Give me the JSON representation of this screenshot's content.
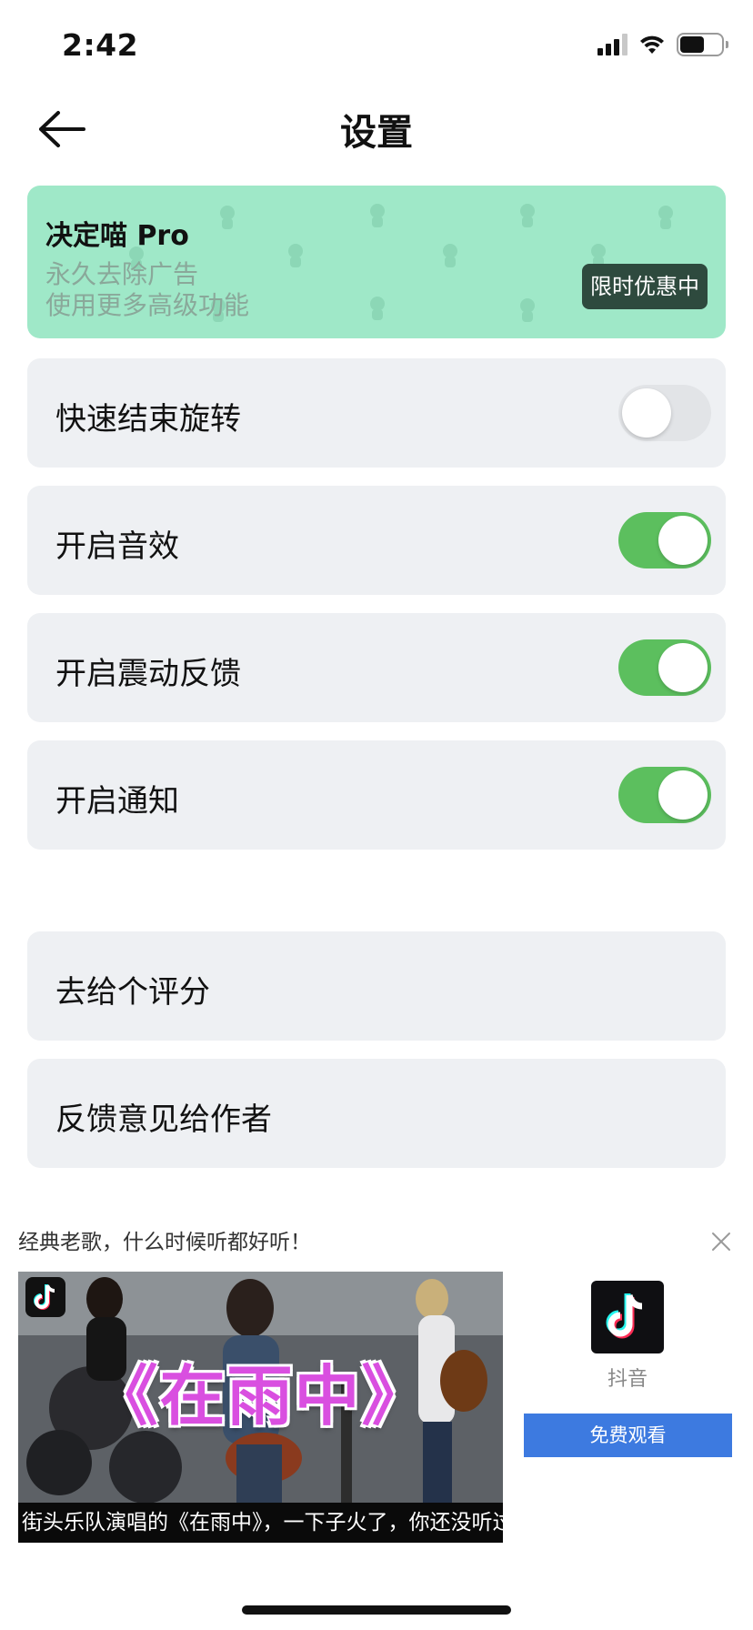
{
  "status_bar": {
    "time": "2:42",
    "battery_level": 0.58
  },
  "header": {
    "title": "设置",
    "back_icon": "arrow-left-icon"
  },
  "pro_banner": {
    "title": "决定喵 Pro",
    "line1": "永久去除广告",
    "line2": "使用更多高级功能",
    "deal_label": "限时优惠中",
    "background": "#9fe8c8"
  },
  "settings": [
    {
      "label": "快速结束旋转",
      "enabled": false
    },
    {
      "label": "开启音效",
      "enabled": true
    },
    {
      "label": "开启震动反馈",
      "enabled": true
    },
    {
      "label": "开启通知",
      "enabled": true
    }
  ],
  "actions": [
    {
      "label": "去给个评分"
    },
    {
      "label": "反馈意见给作者"
    }
  ],
  "ad": {
    "headline": "经典老歌，什么时候听都好听！",
    "video_title": "《在雨中》",
    "video_caption": "街头乐队演唱的《在雨中》，一下子火了，你还没听过么?",
    "app_name": "抖音",
    "cta_label": "免费观看",
    "cta_color": "#3d7ae0"
  },
  "colors": {
    "toggle_on": "#5cbf5e",
    "row_bg": "#eef0f3"
  }
}
